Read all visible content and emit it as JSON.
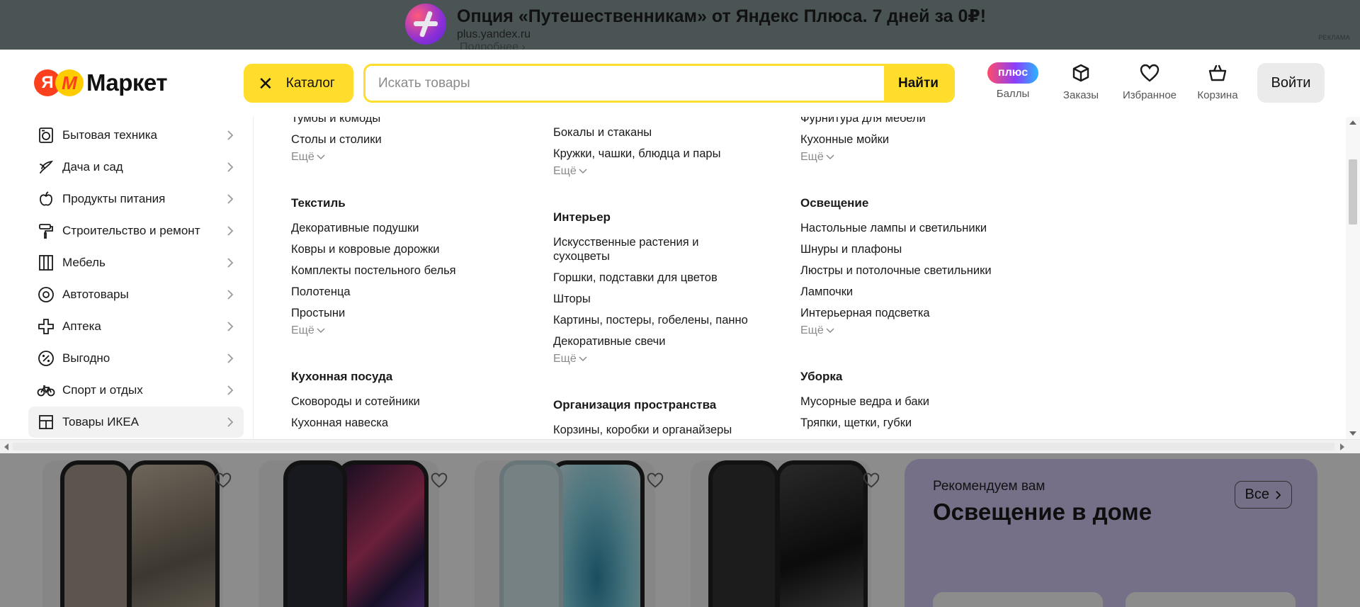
{
  "ad": {
    "title": "Опция «Путешественникам» от Яндекс Плюса. 7 дней за 0₽!",
    "domain": "plus.yandex.ru",
    "more": "Подробнее ›",
    "label": "РЕКЛАМА"
  },
  "header": {
    "logo_ya": "Я",
    "logo_m": "М",
    "logo_text": "Маркет",
    "catalog_label": "Каталог",
    "search_placeholder": "Искать товары",
    "search_button": "Найти",
    "plus_badge": "плюс",
    "points_label": "Баллы",
    "orders_label": "Заказы",
    "favorites_label": "Избранное",
    "cart_label": "Корзина",
    "login_label": "Войти"
  },
  "sidebar": {
    "items": [
      {
        "label": "Бытовая техника",
        "icon": "appliance-icon"
      },
      {
        "label": "Дача и сад",
        "icon": "plant-icon"
      },
      {
        "label": "Продукты питания",
        "icon": "apple-icon"
      },
      {
        "label": "Строительство и ремонт",
        "icon": "paint-roller-icon"
      },
      {
        "label": "Мебель",
        "icon": "furniture-icon"
      },
      {
        "label": "Автотовары",
        "icon": "wheel-icon"
      },
      {
        "label": "Аптека",
        "icon": "cross-icon"
      },
      {
        "label": "Выгодно",
        "icon": "percent-icon"
      },
      {
        "label": "Спорт и отдых",
        "icon": "bicycle-icon"
      },
      {
        "label": "Товары ИКЕА",
        "icon": "ikea-shelf-icon",
        "active": true
      }
    ]
  },
  "columns": {
    "col1": {
      "top_links": [
        "Тумбы и комоды",
        "Столы и столики"
      ],
      "more1": "Ещё",
      "textile_heading": "Текстиль",
      "textile_links": [
        "Декоративные подушки",
        "Ковры и ковровые дорожки",
        "Комплекты постельного белья",
        "Полотенца",
        "Простыни"
      ],
      "more2": "Ещё",
      "cookware_heading": "Кухонная посуда",
      "cookware_links": [
        "Сковороды и сотейники",
        "Кухонная навеска"
      ]
    },
    "col2": {
      "top_links": [
        "Бокалы и стаканы",
        "Кружки, чашки, блюдца и пары"
      ],
      "more1": "Ещё",
      "interior_heading": "Интерьер",
      "interior_links": [
        "Искусственные растения и",
        "сухоцветы",
        "Горшки, подставки для цветов",
        "Шторы",
        "Картины, постеры, гобелены, панно",
        "Декоративные свечи"
      ],
      "more2": "Ещё",
      "org_heading": "Организация пространства",
      "org_links": [
        "Корзины, коробки и органайзеры"
      ]
    },
    "col3": {
      "top_links": [
        "Фурнитура для мебели",
        "Кухонные мойки"
      ],
      "more1": "Ещё",
      "light_heading": "Освещение",
      "light_links": [
        "Настольные лампы и светильники",
        "Шнуры и плафоны",
        "Люстры и потолочные светильники",
        "Лампочки",
        "Интерьерная подсветка"
      ],
      "more2": "Ещё",
      "clean_heading": "Уборка",
      "clean_links": [
        "Мусорные ведра и баки",
        "Тряпки, щетки, губки"
      ]
    }
  },
  "recommend": {
    "small": "Рекомендуем вам",
    "title": "Освещение в доме",
    "all_label": "Все"
  },
  "colors": {
    "accent_yellow": "#ffdd2d",
    "brand_red": "#fc3f1d",
    "recommend_bg": "#d6cdf7"
  }
}
